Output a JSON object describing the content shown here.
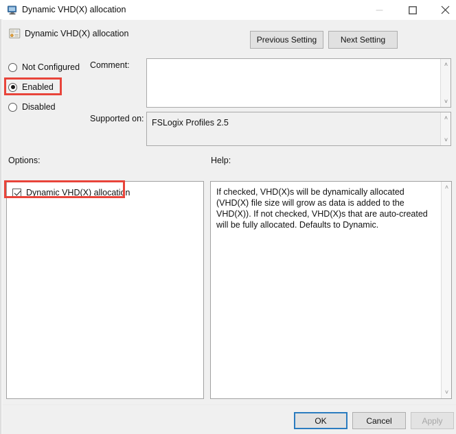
{
  "window": {
    "title": "Dynamic VHD(X) allocation",
    "title_icon": "computer-monitor-icon",
    "controls": {
      "minimize": "–",
      "maximize": "☐",
      "close": "✕"
    }
  },
  "header": {
    "policy_icon": "group-policy-setting-icon",
    "policy_title": "Dynamic VHD(X) allocation",
    "previous_button": "Previous Setting",
    "next_button": "Next Setting"
  },
  "state": {
    "options": [
      {
        "label": "Not Configured",
        "selected": false
      },
      {
        "label": "Enabled",
        "selected": true
      },
      {
        "label": "Disabled",
        "selected": false
      }
    ]
  },
  "comment": {
    "label": "Comment:",
    "value": "",
    "scroll_up": "˄",
    "scroll_down": "˅"
  },
  "supported": {
    "label": "Supported on:",
    "value": "FSLogix Profiles 2.5",
    "scroll_up": "˄",
    "scroll_down": "˅"
  },
  "options_panel": {
    "label": "Options:",
    "checkbox": {
      "label": "Dynamic VHD(X) allocation",
      "checked": true
    }
  },
  "help_panel": {
    "label": "Help:",
    "text": "If checked, VHD(X)s will be dynamically allocated (VHD(X) file size will grow as data is added to the VHD(X)). If not checked, VHD(X)s that are auto-created will be fully allocated. Defaults to Dynamic.",
    "scroll_up": "˄",
    "scroll_down": "˅"
  },
  "footer": {
    "ok": "OK",
    "cancel": "Cancel",
    "apply": "Apply",
    "apply_enabled": false
  },
  "annotations": {
    "color": "#e8443a",
    "targets": [
      "enabled-radio",
      "dynamic-vhdx-checkbox"
    ]
  }
}
